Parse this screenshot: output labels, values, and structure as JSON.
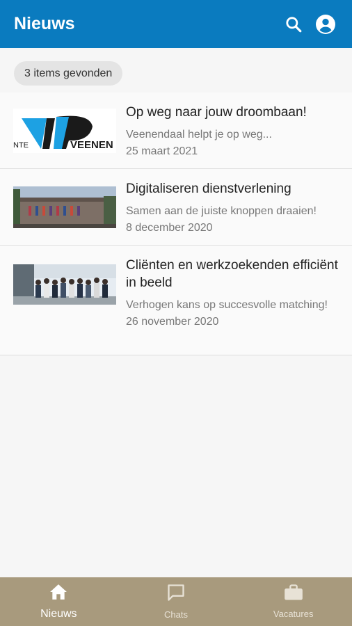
{
  "appbar": {
    "title": "Nieuws"
  },
  "chip": {
    "label": "3 items gevonden"
  },
  "news": [
    {
      "title": "Op weg naar jouw droombaan!",
      "subtitle": "Veenendaal helpt je op weg...",
      "date": "25 maart 2021",
      "logo_text_left": "NTE",
      "logo_text_right": "VEENEN"
    },
    {
      "title": "Digitaliseren dienstverlening",
      "subtitle": "Samen aan de juiste knoppen draaien!",
      "date": "8 december 2020"
    },
    {
      "title": "Cliënten en werkzoekenden efficiënt in beeld",
      "subtitle": "Verhogen kans op succesvolle matching!",
      "date": "26 november 2020"
    }
  ],
  "nav": {
    "items": [
      {
        "label": "Nieuws",
        "icon": "home-icon",
        "active": true
      },
      {
        "label": "Chats",
        "icon": "chat-icon",
        "active": false
      },
      {
        "label": "Vacatures",
        "icon": "briefcase-icon",
        "active": false
      }
    ]
  },
  "colors": {
    "primary": "#0a7bbf",
    "navbar": "#a89a7d"
  }
}
